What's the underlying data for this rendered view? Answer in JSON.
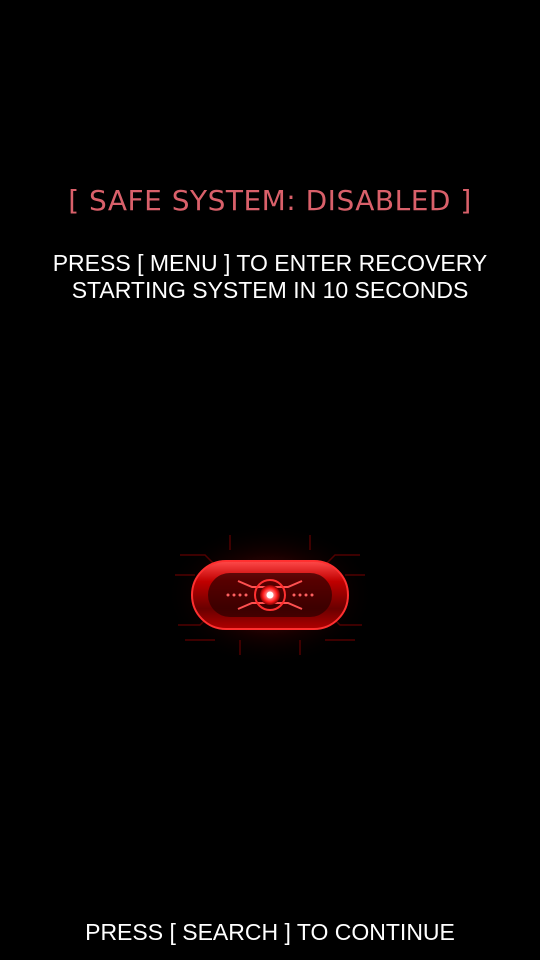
{
  "boot_screen": {
    "safe_system_status": "[ SAFE SYSTEM: DISABLED ]",
    "recovery_instruction": "PRESS [ MENU ] TO ENTER RECOVERY",
    "countdown_text": "STARTING SYSTEM IN 10 SECONDS",
    "continue_instruction": "PRESS [ SEARCH ] TO CONTINUE"
  },
  "logo": {
    "icon": "red-eye-logo-icon"
  },
  "colors": {
    "background": "#000000",
    "status_text": "#d9606a",
    "body_text": "#ffffff",
    "logo_red": "#ff2a2a"
  }
}
